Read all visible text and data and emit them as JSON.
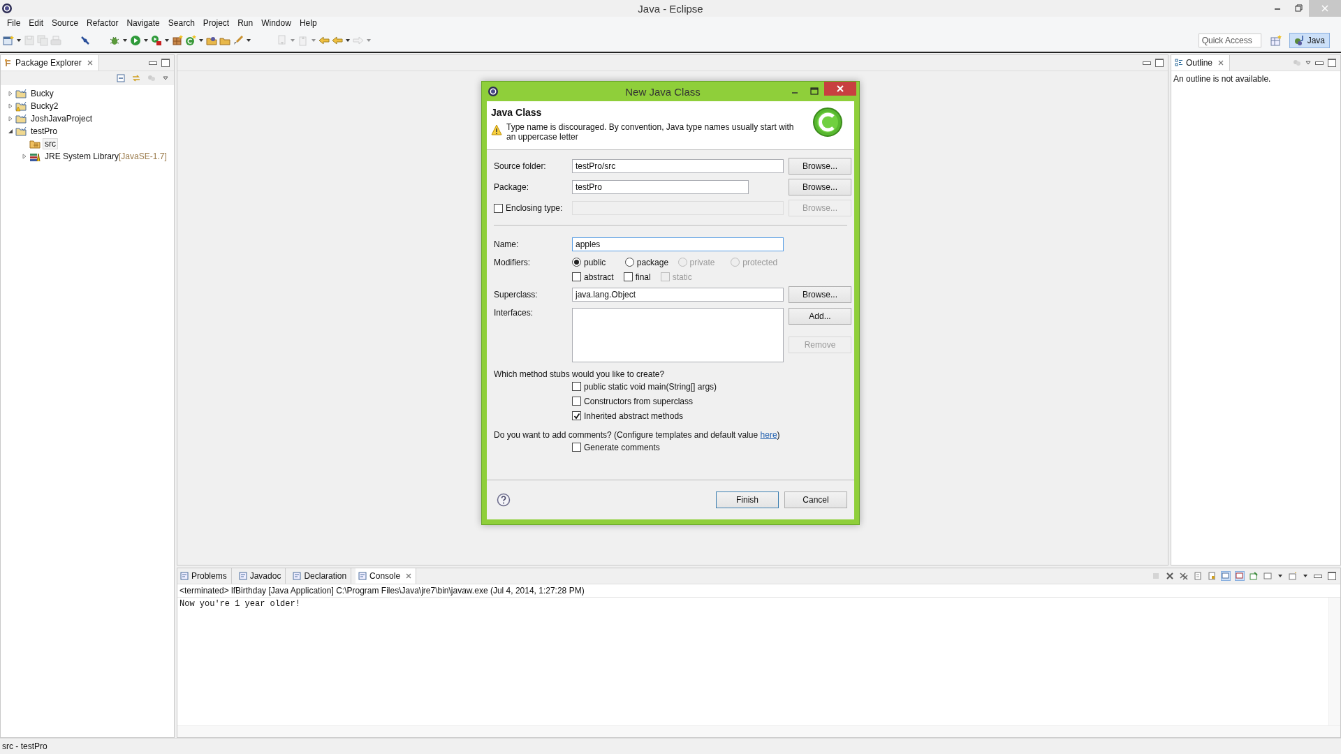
{
  "window": {
    "title": "Java - Eclipse"
  },
  "menu": [
    "File",
    "Edit",
    "Source",
    "Refactor",
    "Navigate",
    "Search",
    "Project",
    "Run",
    "Window",
    "Help"
  ],
  "toolbar": {
    "quick_access": {
      "placeholder": "Quick Access"
    },
    "perspective": {
      "label": "Java",
      "selected": true
    }
  },
  "package_explorer": {
    "title": "Package Explorer",
    "tree": [
      {
        "label": "Bucky",
        "expanded": false,
        "warning": false,
        "selected": false
      },
      {
        "label": "Bucky2",
        "expanded": false,
        "warning": true,
        "selected": false
      },
      {
        "label": "JoshJavaProject",
        "expanded": false,
        "warning": false,
        "selected": false
      },
      {
        "label": "testPro",
        "expanded": true,
        "warning": false,
        "selected": false,
        "children": [
          {
            "label": "src",
            "kind": "source-folder",
            "selected": true
          },
          {
            "label": "JRE System Library",
            "suffix": "[JavaSE-1.7]",
            "kind": "library",
            "expanded": false,
            "selected": false
          }
        ]
      }
    ]
  },
  "outline": {
    "title": "Outline",
    "message": "An outline is not available."
  },
  "dialog": {
    "title": "New Java Class",
    "heading": "Java Class",
    "message": "Type name is discouraged. By convention, Java type names usually start with an uppercase letter",
    "source_folder": {
      "label": "Source folder:",
      "value": "testPro/src",
      "button": "Browse..."
    },
    "package": {
      "label": "Package:",
      "value": "testPro",
      "button": "Browse..."
    },
    "enclosing_type": {
      "label": "Enclosing type:",
      "checked": false,
      "button": "Browse...",
      "disabled": true
    },
    "name": {
      "label": "Name:",
      "value": "apples",
      "focused": true
    },
    "modifiers": {
      "label": "Modifiers:",
      "access": [
        {
          "label": "public",
          "selected": true,
          "disabled": false
        },
        {
          "label": "package",
          "selected": false,
          "disabled": false
        },
        {
          "label": "private",
          "selected": false,
          "disabled": true
        },
        {
          "label": "protected",
          "selected": false,
          "disabled": true
        }
      ],
      "flags": [
        {
          "label": "abstract",
          "checked": false,
          "disabled": false
        },
        {
          "label": "final",
          "checked": false,
          "disabled": false
        },
        {
          "label": "static",
          "checked": false,
          "disabled": true
        }
      ]
    },
    "superclass": {
      "label": "Superclass:",
      "value": "java.lang.Object",
      "button": "Browse..."
    },
    "interfaces": {
      "label": "Interfaces:",
      "add_button": "Add...",
      "remove_button": "Remove",
      "remove_disabled": true
    },
    "stubs_question": "Which method stubs would you like to create?",
    "stubs": [
      {
        "label": "public static void main(String[] args)",
        "checked": false
      },
      {
        "label": "Constructors from superclass",
        "checked": false
      },
      {
        "label": "Inherited abstract methods",
        "checked": true
      }
    ],
    "comments_question": "Do you want to add comments? (Configure templates and default value ",
    "comments_link": "here",
    "comments_end": ")",
    "generate_comments": {
      "label": "Generate comments",
      "checked": false
    },
    "finish": "Finish",
    "cancel": "Cancel"
  },
  "bottom_panel": {
    "tabs": [
      {
        "label": "Problems",
        "selected": false
      },
      {
        "label": "Javadoc",
        "selected": false
      },
      {
        "label": "Declaration",
        "selected": false
      },
      {
        "label": "Console",
        "selected": true
      }
    ],
    "status": "<terminated> lfBirthday [Java Application] C:\\Program Files\\Java\\jre7\\bin\\javaw.exe (Jul 4, 2014, 1:27:28 PM)",
    "output": "Now you're 1 year older!"
  },
  "status_bar": "src - testPro"
}
